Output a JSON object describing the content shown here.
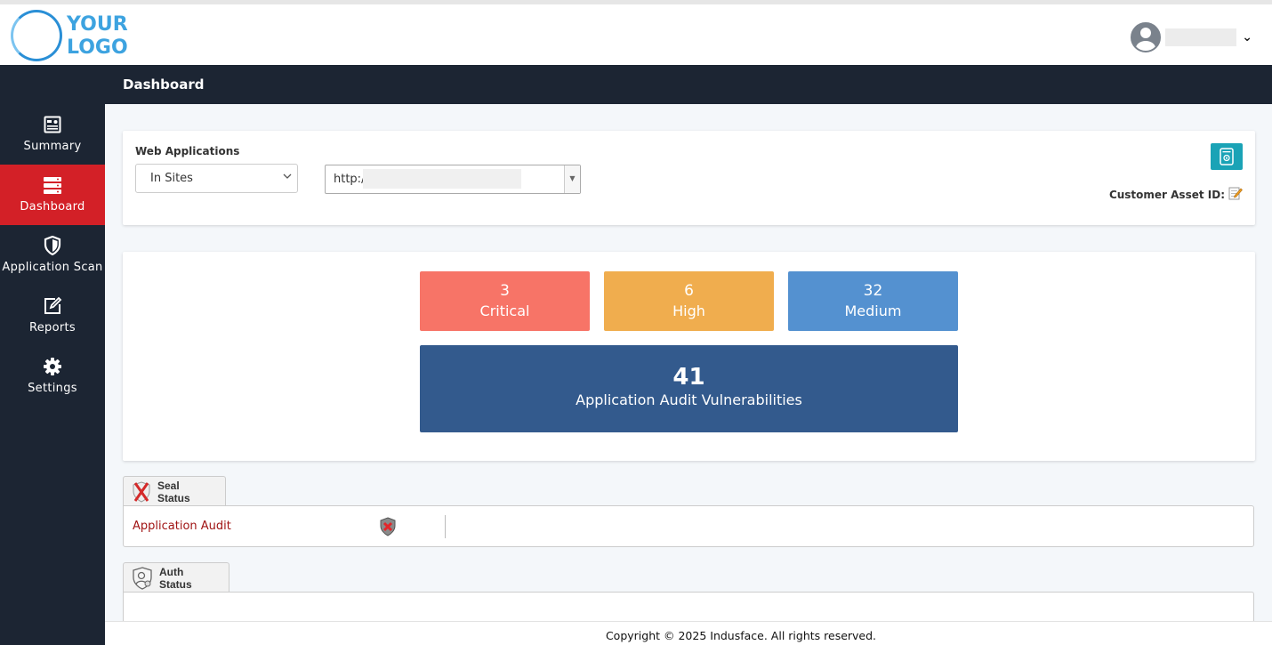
{
  "logo": {
    "line1": "YOUR",
    "line2": "LOGO"
  },
  "header": {
    "page_title": "Dashboard"
  },
  "user": {
    "menu_caret": "⌄"
  },
  "sidebar": {
    "items": [
      {
        "label": "Summary",
        "icon": "summary-icon",
        "active": false
      },
      {
        "label": "Dashboard",
        "icon": "server-icon",
        "active": true
      },
      {
        "label": "Application Scan",
        "icon": "shield-icon",
        "active": false
      },
      {
        "label": "Reports",
        "icon": "edit-icon",
        "active": false
      },
      {
        "label": "Settings",
        "icon": "gear-icon",
        "active": false
      }
    ]
  },
  "filter": {
    "label": "Web Applications",
    "scope_select": "In Sites",
    "url_select": "http:/",
    "customer_asset_label": "Customer Asset ID:"
  },
  "stats": {
    "critical": {
      "count": "3",
      "label": "Critical"
    },
    "high": {
      "count": "6",
      "label": "High"
    },
    "medium": {
      "count": "32",
      "label": "Medium"
    },
    "total": {
      "count": "41",
      "label": "Application Audit Vulnerabilities"
    }
  },
  "colors": {
    "critical": "#f77467",
    "high": "#f0ad4e",
    "medium": "#5491d0",
    "total": "#335a8d",
    "active_nav": "#d32027",
    "sidebar": "#1c2533"
  },
  "seal_status": {
    "tab_label": "Seal Status",
    "row_label": "Application Audit"
  },
  "auth_status": {
    "tab_label": "Auth Status"
  },
  "footer": {
    "copyright": "Copyright © 2025 Indusface. All rights reserved."
  }
}
